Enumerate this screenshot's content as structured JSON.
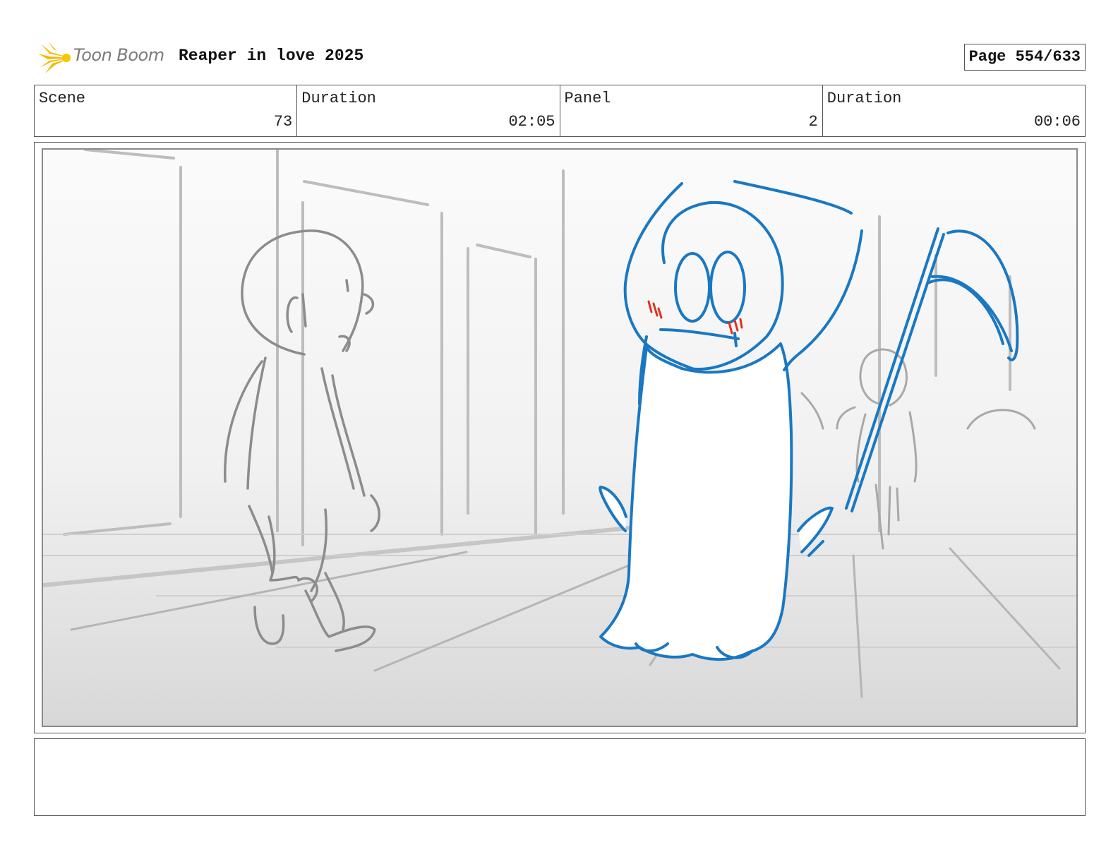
{
  "header": {
    "logo_text": "Toon Boom",
    "title": "Reaper in love 2025",
    "page_label": "Page 554/633"
  },
  "info": {
    "scene_label": "Scene",
    "scene_value": "73",
    "scene_duration_label": "Duration",
    "scene_duration_value": "02:05",
    "panel_label": "Panel",
    "panel_value": "2",
    "panel_duration_label": "Duration",
    "panel_duration_value": "00:06"
  },
  "colors": {
    "logo_yellow": "#f5b800",
    "sketch_gray": "#8c8c8c",
    "reaper_blue": "#1a78c2",
    "blush_red": "#e0321e"
  },
  "notes": {
    "text": ""
  }
}
